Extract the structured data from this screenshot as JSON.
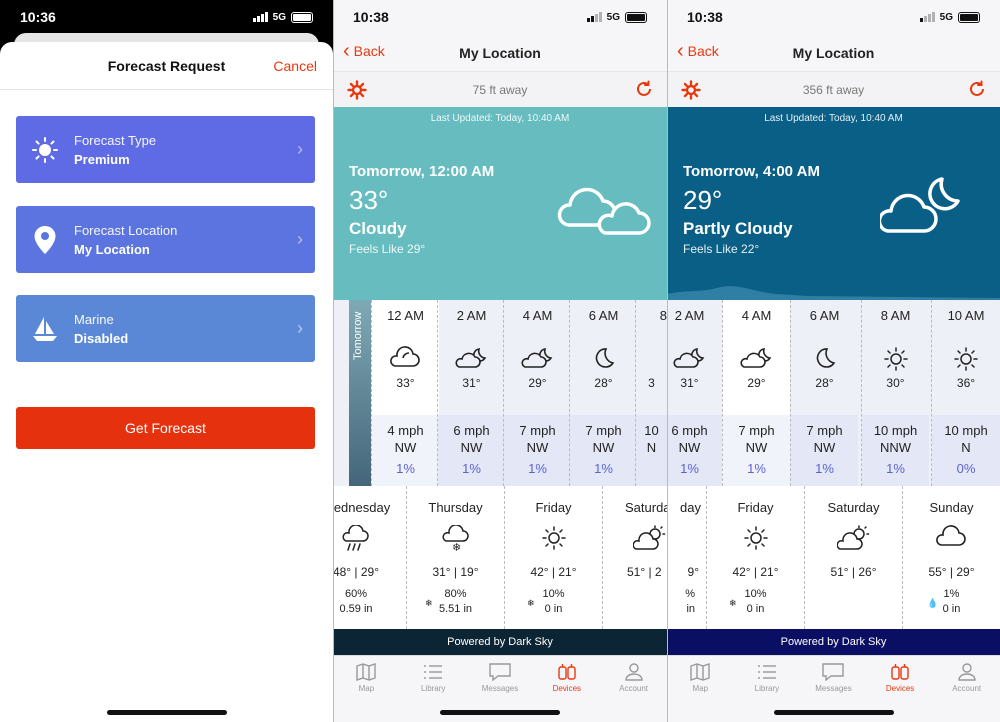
{
  "panel1": {
    "status": {
      "time": "10:36",
      "network": "5G"
    },
    "sheet": {
      "title": "Forecast Request",
      "cancel": "Cancel"
    },
    "cards": [
      {
        "label": "Forecast Type",
        "value": "Premium",
        "icon": "sun-icon",
        "color": "#5e6be4"
      },
      {
        "label": "Forecast Location",
        "value": "My Location",
        "icon": "location-pin-icon",
        "color": "#5b74e0"
      },
      {
        "label": "Marine",
        "value": "Disabled",
        "icon": "sailboat-icon",
        "color": "#5b88d6"
      }
    ],
    "button": "Get Forecast"
  },
  "panel2": {
    "status": {
      "time": "10:38",
      "network": "5G"
    },
    "nav": {
      "back": "Back",
      "title": "My Location"
    },
    "distance": "75 ft away",
    "hero": {
      "updated": "Last Updated: Today, 10:40 AM",
      "when": "Tomorrow, 12:00 AM",
      "temp": "33°",
      "condition": "Cloudy",
      "feels": "Feels Like 29°",
      "color": "#66bcbf"
    },
    "tomorrow_label": "Tomorrow",
    "hours": [
      {
        "time": "12 AM",
        "icon": "cloudy-icon",
        "temp": "33°",
        "wind_speed": "4 mph",
        "wind_dir": "NW",
        "precip": "1%"
      },
      {
        "time": "2 AM",
        "icon": "partly-cloudy-night-icon",
        "temp": "31°",
        "wind_speed": "6 mph",
        "wind_dir": "NW",
        "precip": "1%"
      },
      {
        "time": "4 AM",
        "icon": "partly-cloudy-night-icon",
        "temp": "29°",
        "wind_speed": "7 mph",
        "wind_dir": "NW",
        "precip": "1%"
      },
      {
        "time": "6 AM",
        "icon": "moon-icon",
        "temp": "28°",
        "wind_speed": "7 mph",
        "wind_dir": "NW",
        "precip": "1%"
      },
      {
        "time": "8",
        "icon": "sun-icon",
        "temp": "3",
        "wind_speed": "10",
        "wind_dir": "N",
        "precip": ""
      }
    ],
    "days": [
      {
        "day": "Wednesday",
        "icon": "rain-icon",
        "temps": "48° | 29°",
        "chance": "60%",
        "amount": "0.59 in",
        "snow": false
      },
      {
        "day": "Thursday",
        "icon": "snow-icon",
        "temps": "31° | 19°",
        "chance": "80%",
        "amount": "5.51 in",
        "snow": true
      },
      {
        "day": "Friday",
        "icon": "sun-icon",
        "temps": "42° | 21°",
        "chance": "10%",
        "amount": "0 in",
        "snow": true
      },
      {
        "day": "Saturday",
        "icon": "partly-cloudy-day-icon",
        "temps": "51° | 2",
        "chance": "",
        "amount": "",
        "snow": false
      }
    ],
    "powered": "Powered by Dark Sky"
  },
  "panel3": {
    "status": {
      "time": "10:38",
      "network": "5G"
    },
    "nav": {
      "back": "Back",
      "title": "My Location"
    },
    "distance": "356 ft away",
    "hero": {
      "updated": "Last Updated: Today, 10:40 AM",
      "when": "Tomorrow, 4:00 AM",
      "temp": "29°",
      "condition": "Partly Cloudy",
      "feels": "Feels Like 22°",
      "color": "#0a5f86"
    },
    "hours": [
      {
        "time": "2 AM",
        "icon": "partly-cloudy-night-icon",
        "temp": "31°",
        "wind_speed": "6 mph",
        "wind_dir": "NW",
        "precip": "1%"
      },
      {
        "time": "4 AM",
        "icon": "partly-cloudy-night-icon",
        "temp": "29°",
        "wind_speed": "7 mph",
        "wind_dir": "NW",
        "precip": "1%"
      },
      {
        "time": "6 AM",
        "icon": "moon-icon",
        "temp": "28°",
        "wind_speed": "7 mph",
        "wind_dir": "NW",
        "precip": "1%"
      },
      {
        "time": "8 AM",
        "icon": "sun-icon",
        "temp": "30°",
        "wind_speed": "10 mph",
        "wind_dir": "NNW",
        "precip": "1%"
      },
      {
        "time": "10 AM",
        "icon": "sun-icon",
        "temp": "36°",
        "wind_speed": "10 mph",
        "wind_dir": "N",
        "precip": "0%"
      }
    ],
    "days": [
      {
        "day": "day",
        "icon": "partly-cloudy-day-icon",
        "temps": "9°",
        "chance": "%",
        "amount": "in",
        "snow": false
      },
      {
        "day": "Friday",
        "icon": "sun-icon",
        "temps": "42° | 21°",
        "chance": "10%",
        "amount": "0 in",
        "snow": true
      },
      {
        "day": "Saturday",
        "icon": "partly-cloudy-day-icon",
        "temps": "51° | 26°",
        "chance": "",
        "amount": "",
        "snow": false
      },
      {
        "day": "Sunday",
        "icon": "cloudy-icon",
        "temps": "55° | 29°",
        "chance": "1%",
        "amount": "0 in",
        "snow": false,
        "rain": true
      }
    ],
    "powered": "Powered by Dark Sky"
  },
  "tabs": [
    {
      "label": "Map",
      "icon": "map-icon"
    },
    {
      "label": "Library",
      "icon": "list-icon"
    },
    {
      "label": "Messages",
      "icon": "message-icon"
    },
    {
      "label": "Devices",
      "icon": "devices-icon",
      "active": true
    },
    {
      "label": "Account",
      "icon": "account-icon"
    }
  ],
  "colors": {
    "accent": "#e8380d",
    "precip": "#5b62d6"
  }
}
